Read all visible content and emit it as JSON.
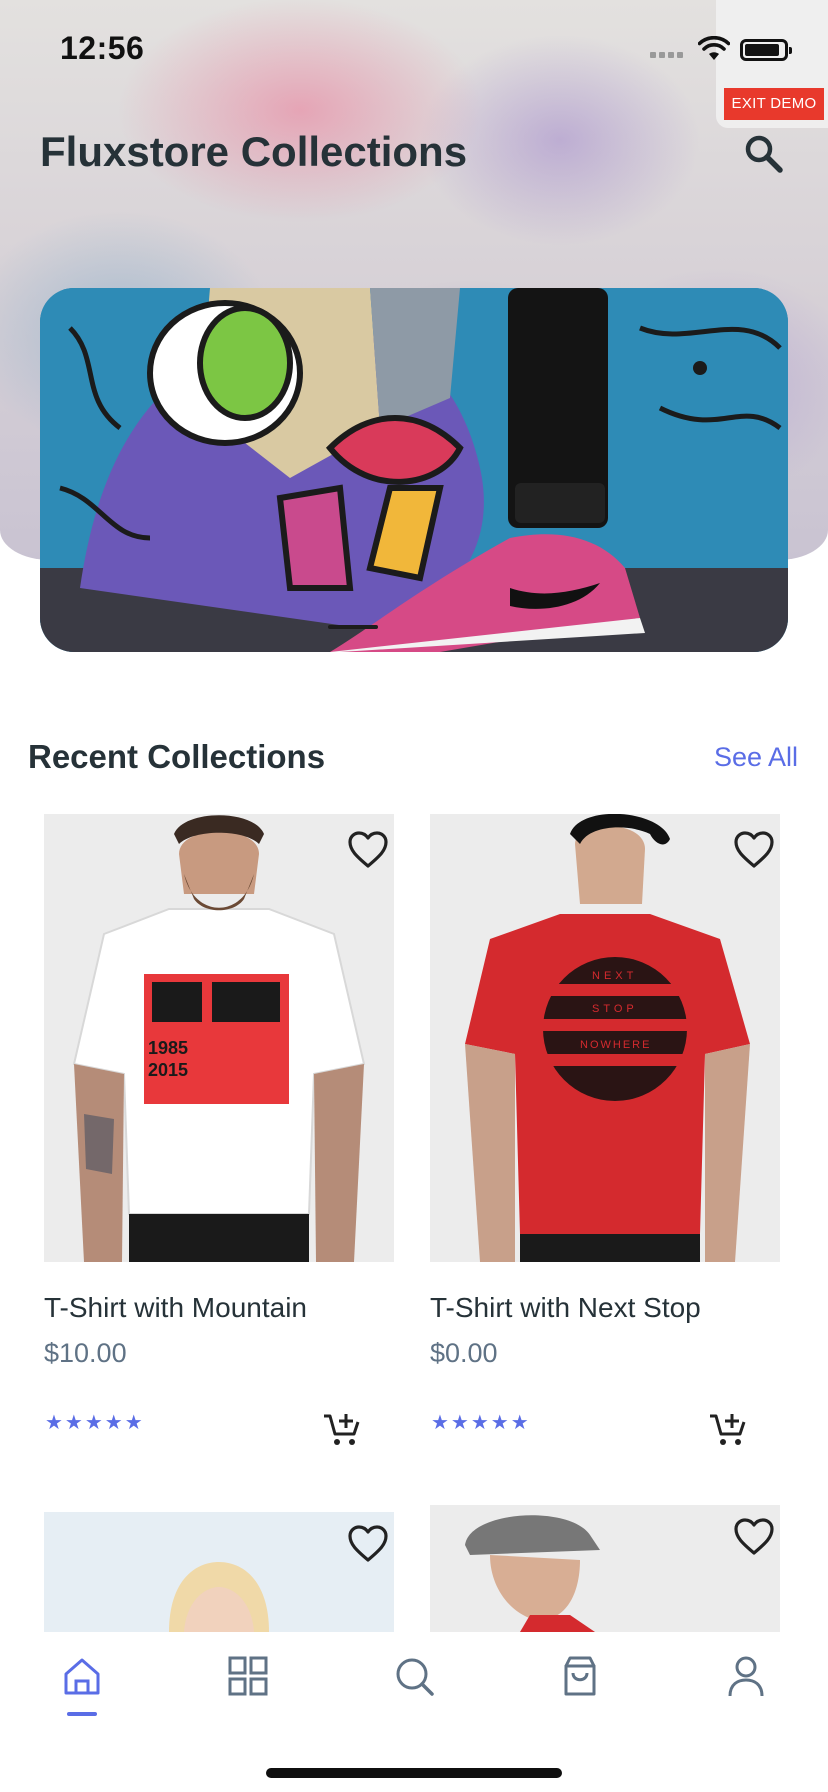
{
  "status_bar": {
    "time": "12:56",
    "exit_demo": "EXIT DEMO"
  },
  "header": {
    "title": "Fluxstore Collections"
  },
  "section": {
    "title": "Recent Collections",
    "see_all": "See All"
  },
  "products": [
    {
      "name": "T-Shirt with Mountain",
      "price": "$10.00",
      "rating_stars": 5,
      "stars_text": "★★★★★",
      "shirt_color": "#ffffff",
      "print_text": [
        "1985",
        "2015"
      ]
    },
    {
      "name": "T-Shirt with Next Stop",
      "price": "$0.00",
      "rating_stars": 5,
      "stars_text": "★★★★★",
      "shirt_color": "#d42a2e",
      "print_text": [
        "NEXT",
        "STOP",
        "NOWHERE"
      ]
    }
  ],
  "nav": {
    "items": [
      {
        "name": "home-icon",
        "active": true
      },
      {
        "name": "grid-icon",
        "active": false
      },
      {
        "name": "search-icon",
        "active": false
      },
      {
        "name": "bag-icon",
        "active": false
      },
      {
        "name": "profile-icon",
        "active": false
      }
    ]
  },
  "colors": {
    "accent": "#5a6de6",
    "exit_demo": "#e8392c",
    "title": "#263238",
    "price": "#5f7285"
  }
}
